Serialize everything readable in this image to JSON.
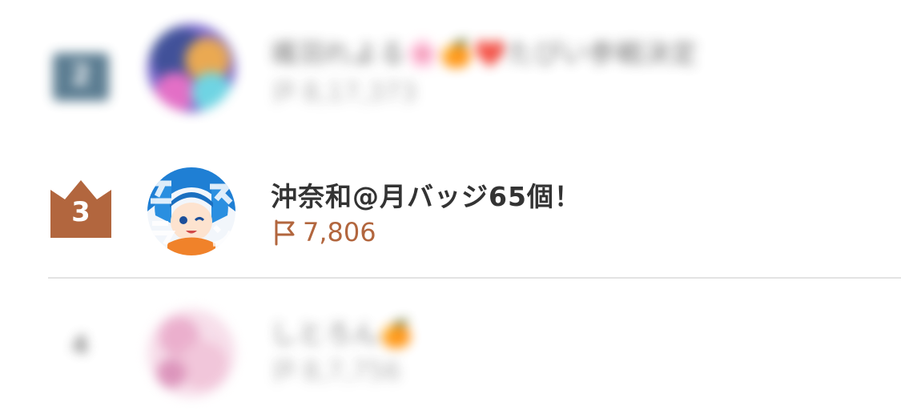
{
  "ranking": {
    "entries": [
      {
        "rank": "2",
        "name": "颯羽れよる🌸🍊❤️たぴい参戦決定",
        "score": "8,17,373",
        "badge_color": "#4a6f86",
        "blurred": true
      },
      {
        "rank": "3",
        "name": "沖奈和@月バッジ65個！",
        "score": "7,806",
        "badge_color": "#b2663e",
        "blurred": false
      },
      {
        "rank": "4",
        "name": "しとろん🍊",
        "score": "8,7,756",
        "badge_color": "#777777",
        "blurred": true
      }
    ],
    "score_icon": "flag-icon",
    "accent_color": "#b2663e"
  }
}
